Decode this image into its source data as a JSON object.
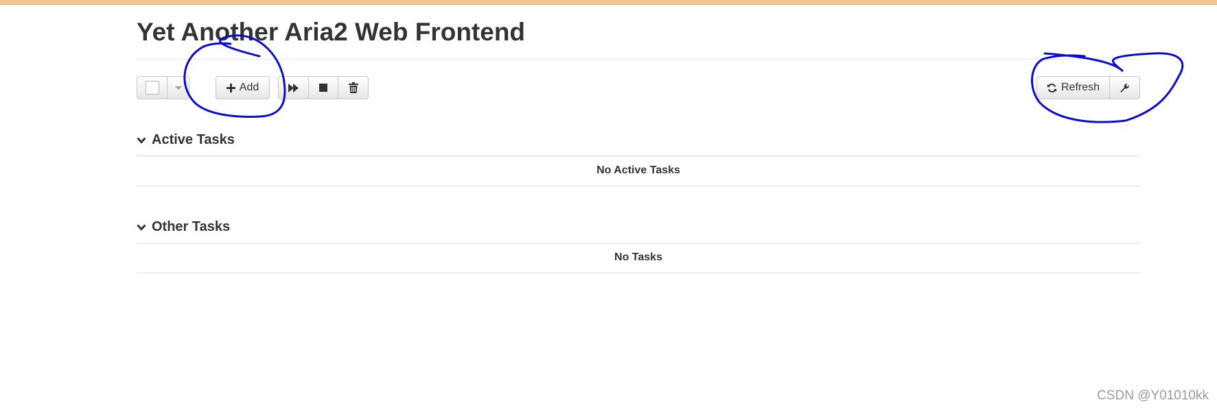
{
  "app": {
    "title": "Yet Another Aria2 Web Frontend"
  },
  "toolbar": {
    "add_label": "Add",
    "refresh_label": "Refresh"
  },
  "sections": {
    "active": {
      "heading": "Active Tasks",
      "empty_message": "No Active Tasks"
    },
    "other": {
      "heading": "Other Tasks",
      "empty_message": "No Tasks"
    }
  },
  "watermark": "CSDN @Y01010kk",
  "icons": {
    "add": "plus-icon",
    "resume": "fast-forward-icon",
    "stop": "stop-icon",
    "remove": "trash-icon",
    "refresh": "refresh-icon",
    "settings": "wrench-icon",
    "section_toggle": "chevron-down-icon"
  },
  "colors": {
    "top_strip": "#f0c594",
    "annotation_ink": "#0000cc",
    "text": "#333333"
  }
}
